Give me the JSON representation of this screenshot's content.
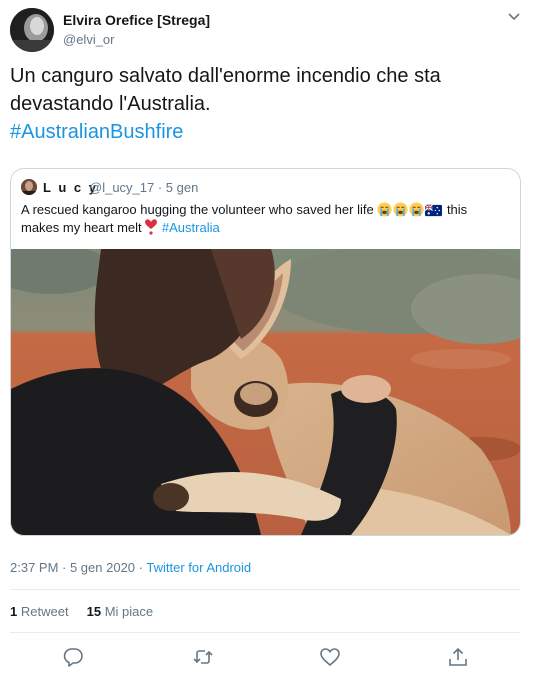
{
  "tweet": {
    "author": {
      "display_name": "Elvira Orefice [Strega]",
      "handle": "@elvi_or"
    },
    "text_lines": [
      "Un canguro salvato dall'enorme incendio che sta",
      "devastando l'Australia."
    ],
    "hashtag": "#AustralianBushfire",
    "quoted": {
      "display_name": "L u c y",
      "handle_time": "@l_ucy_17 · 5 gen",
      "text_line1": "A rescued kangaroo hugging the volunteer who saved her life",
      "text_line1_end": "this",
      "text_line2_start": "makes my heart melt",
      "hashtag": "#Australia",
      "emoji_icons": [
        "sob-emoji-icon",
        "sob-emoji-icon",
        "sob-emoji-icon",
        "australia-flag-icon",
        "red-heart-icon"
      ],
      "media_alt": "kangaroo hugging volunteer"
    },
    "timestamp": "2:37 PM · 5 gen 2020 · ",
    "source": "Twitter for Android",
    "stats": {
      "retweets": "1",
      "retweets_label": "Retweet",
      "likes": "15",
      "likes_label": "Mi piace"
    },
    "action_icons": [
      "reply-icon",
      "retweet-icon",
      "like-icon",
      "share-icon"
    ]
  },
  "colors": {
    "link": "#1b95e0",
    "secondary_text": "#657786",
    "primary_text": "#14171a",
    "border": "#ccd6dd"
  }
}
